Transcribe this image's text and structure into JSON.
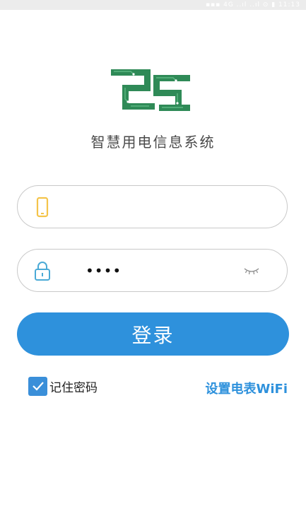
{
  "status_bar": {
    "text": "▪▪▪ 4G ..ıl ..ıl ⊙ ▮ 11:13"
  },
  "app": {
    "title": "智慧用电信息系统",
    "logo_colors": {
      "primary": "#2f8a57",
      "secondary": "#5cb882"
    }
  },
  "form": {
    "phone": {
      "value": "",
      "placeholder": "",
      "icon": "phone-icon",
      "icon_color": "#f4c44a"
    },
    "password": {
      "masked_value": "••••",
      "icon": "lock-icon",
      "icon_color": "#4aaad6",
      "toggle_icon": "eye-closed-icon"
    },
    "login_label": "登录",
    "remember_label": "记住密码",
    "remember_checked": true,
    "wifi_link_label": "设置电表WiFi"
  },
  "colors": {
    "accent": "#2e91dc",
    "border": "#c9c9c9",
    "title_text": "#4a4a4a"
  }
}
